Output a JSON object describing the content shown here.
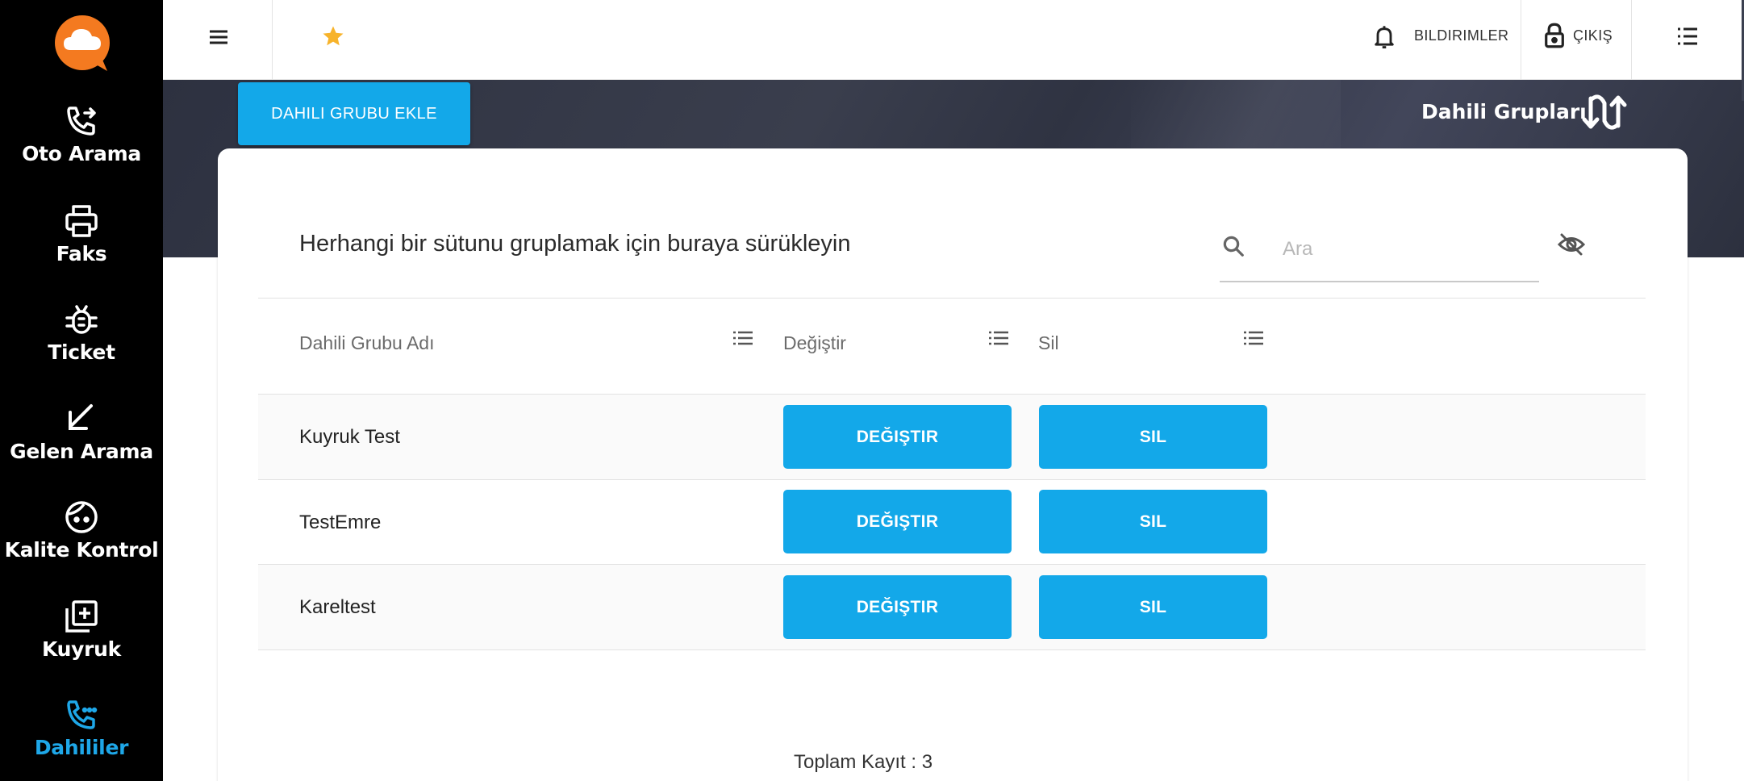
{
  "colors": {
    "accent": "#13a8e9",
    "sidebar_bg": "#000000",
    "active": "#1ea7e8",
    "star": "#f7b32b",
    "logo": "#f47a20"
  },
  "sidebar": {
    "items": [
      {
        "label": "Oto Arama",
        "icon": "phone-forward-icon"
      },
      {
        "label": "Faks",
        "icon": "printer-icon"
      },
      {
        "label": "Ticket",
        "icon": "bug-icon"
      },
      {
        "label": "Gelen Arama",
        "icon": "arrow-down-left-icon"
      },
      {
        "label": "Kalite Kontrol",
        "icon": "face-icon"
      },
      {
        "label": "Kuyruk",
        "icon": "library-add-icon"
      },
      {
        "label": "Dahililer",
        "icon": "phone-dots-icon",
        "active": true
      }
    ]
  },
  "topbar": {
    "notifications_label": "BILDIRIMLER",
    "logout_label": "ÇIKIŞ"
  },
  "header": {
    "add_button_label": "DAHILI GRUBU EKLE",
    "page_title": "Dahili Grupları"
  },
  "grid": {
    "group_hint": "Herhangi bir sütunu gruplamak için buraya sürükleyin",
    "search_placeholder": "Ara",
    "columns": [
      "Dahili Grubu Adı",
      "Değiştir",
      "Sil"
    ],
    "rows": [
      {
        "name": "Kuyruk Test",
        "edit": "DEĞIŞTIR",
        "delete": "SIL"
      },
      {
        "name": "TestEmre",
        "edit": "DEĞIŞTIR",
        "delete": "SIL"
      },
      {
        "name": "Kareltest",
        "edit": "DEĞIŞTIR",
        "delete": "SIL"
      }
    ],
    "total_label": "Toplam Kayıt : 3"
  }
}
